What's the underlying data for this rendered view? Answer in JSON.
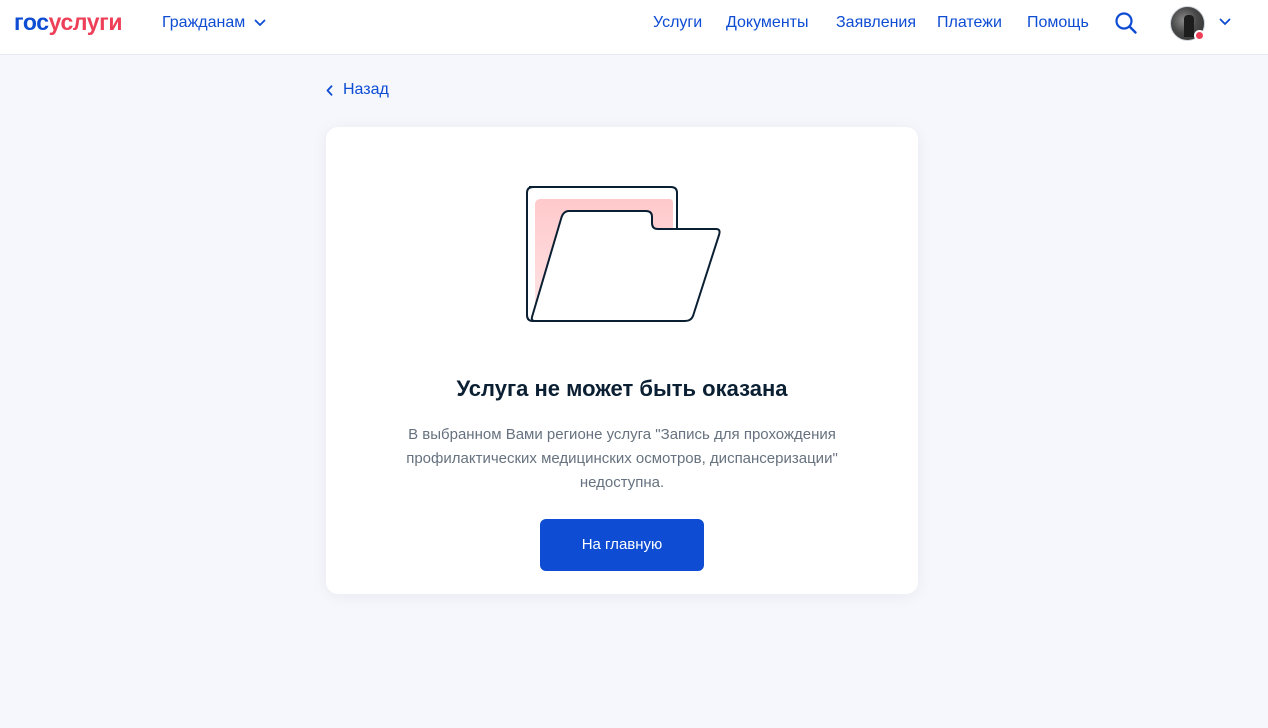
{
  "header": {
    "logo": {
      "part1": "гос",
      "part2": "услуги"
    },
    "audience_label": "Гражданам",
    "nav": [
      {
        "label": "Услуги"
      },
      {
        "label": "Документы"
      },
      {
        "label": "Заявления"
      },
      {
        "label": "Платежи"
      },
      {
        "label": "Помощь"
      }
    ],
    "icons": {
      "search": "search-icon",
      "avatar": "user-avatar",
      "chevron": "chevron-down-icon"
    }
  },
  "back": {
    "label": "Назад"
  },
  "card": {
    "illustration": "open-folder-illustration",
    "title": "Услуга не может быть оказана",
    "text": "В выбранном Вами регионе услуга \"Запись для прохождения профилактических медицинских осмотров, диспансеризации\" недоступна.",
    "button_label": "На главную"
  },
  "colors": {
    "brand_blue": "#0d4cd3",
    "brand_red": "#ee3f58",
    "page_bg": "#f5f7fc",
    "card_bg": "#ffffff",
    "muted_text": "#66727f",
    "title_text": "#0b1f33"
  }
}
